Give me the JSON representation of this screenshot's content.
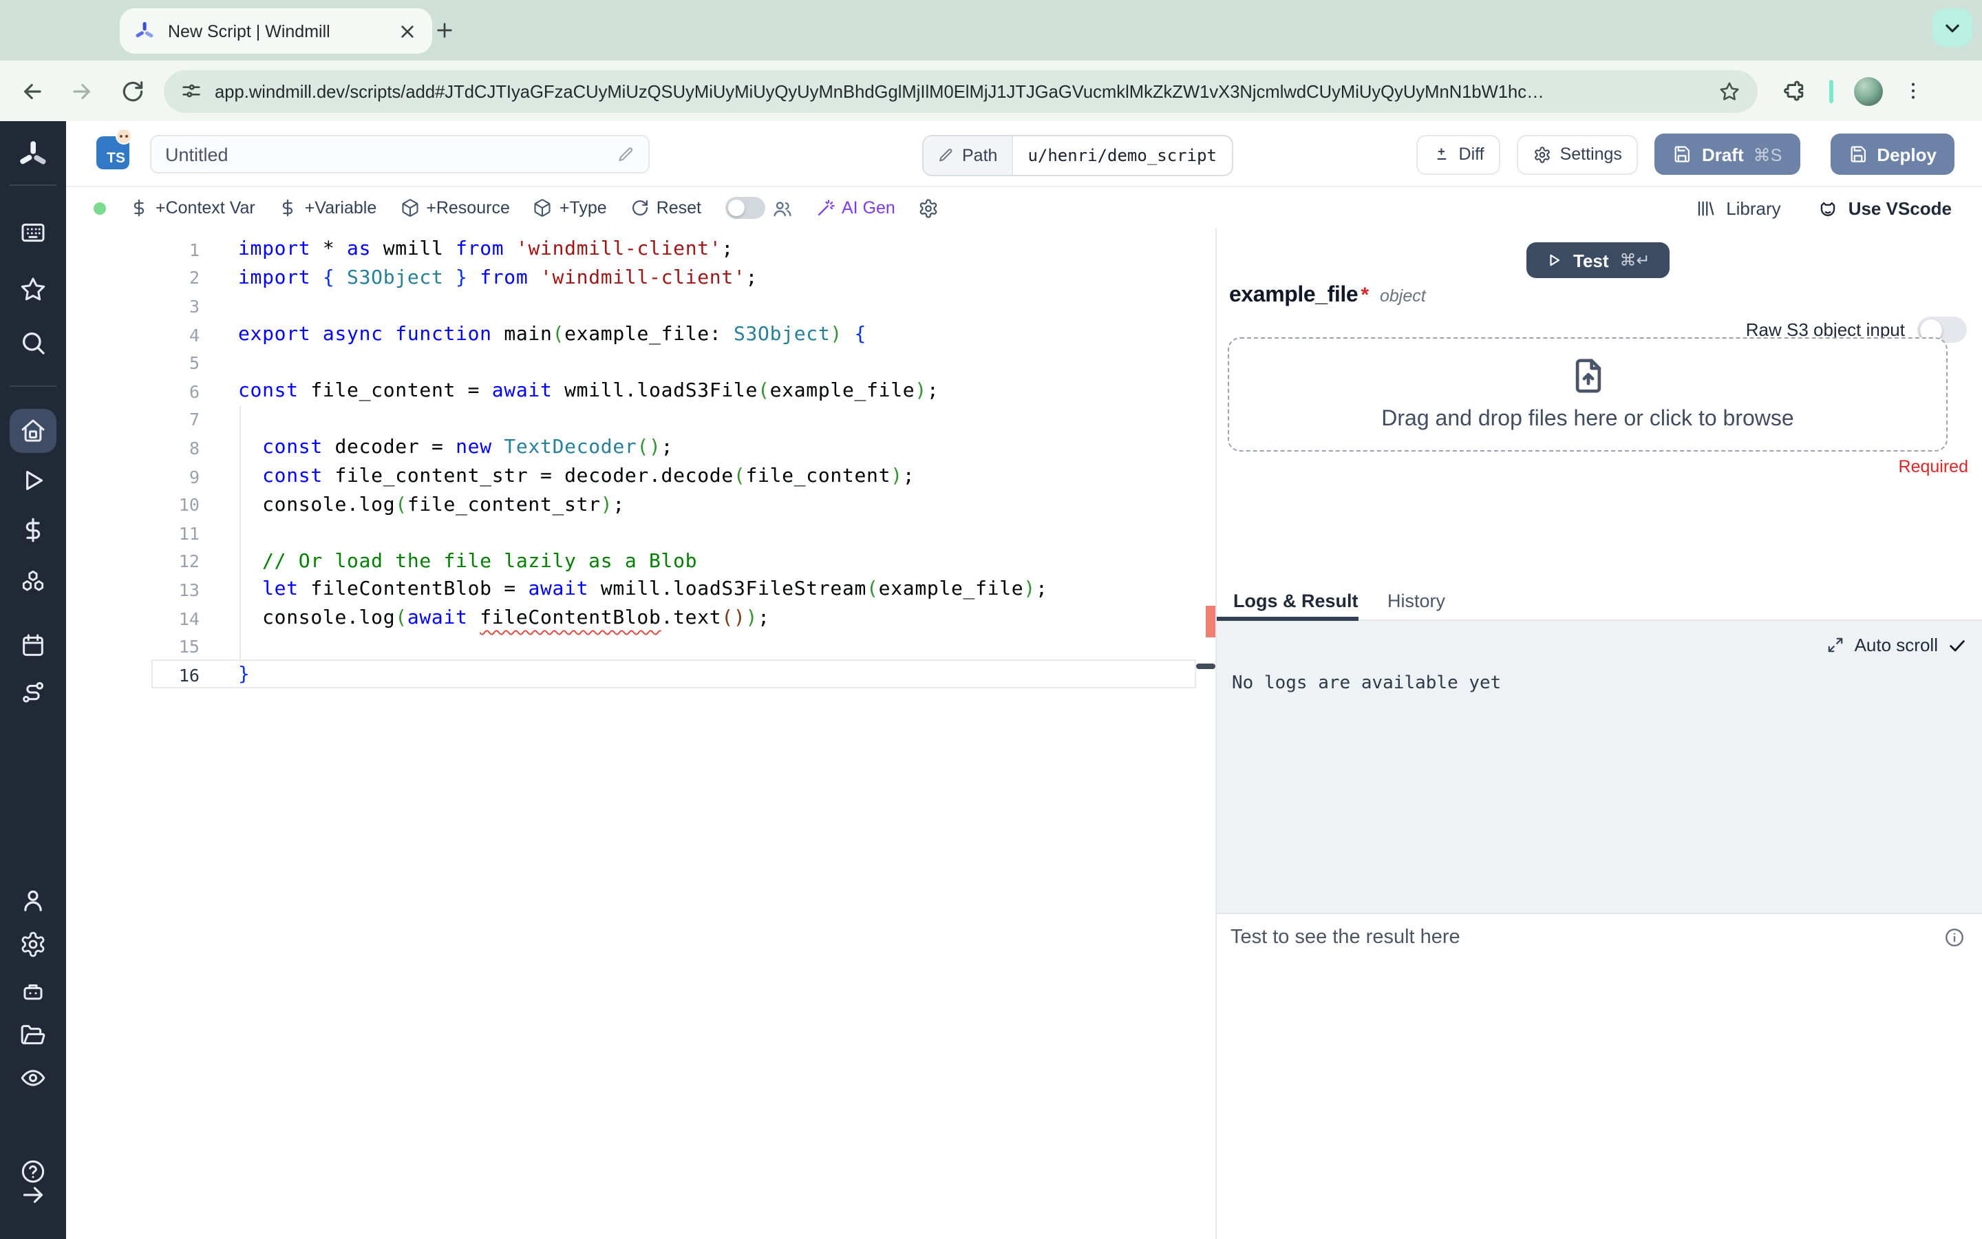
{
  "browser": {
    "tab_title": "New Script | Windmill",
    "url": "app.windmill.dev/scripts/add#JTdCJTIyaGFzaCUyMiUzQSUyMiUyMiUyQyUyMnBhdGglMjIlM0ElMjJ1JTJGaGVucmklMkZkZW1vX3NjcmlwdCUyMiUyQyUyMnN1bW1hc…"
  },
  "header": {
    "language_badge": "TS",
    "title": "Untitled",
    "path_label": "Path",
    "path_value": "u/henri/demo_script",
    "diff_label": "Diff",
    "settings_label": "Settings",
    "draft_label": "Draft",
    "draft_shortcut": "⌘S",
    "deploy_label": "Deploy"
  },
  "toolbar": {
    "context_var": "+Context Var",
    "variable": "+Variable",
    "resource": "+Resource",
    "type": "+Type",
    "reset": "Reset",
    "ai_gen": "AI Gen",
    "library": "Library",
    "use_vscode": "Use VScode"
  },
  "sidebar": {
    "items": [
      {
        "name": "windmill-logo",
        "icon": "windmill-logo"
      },
      {
        "name": "divider"
      },
      {
        "name": "sidebar-item-apps",
        "icon": "apps"
      },
      {
        "name": "sidebar-item-favorites",
        "icon": "favorites"
      },
      {
        "name": "sidebar-item-search",
        "icon": "search"
      },
      {
        "name": "divider"
      },
      {
        "name": "sidebar-item-home",
        "icon": "home",
        "active": true
      },
      {
        "name": "sidebar-item-runs",
        "icon": "runs"
      },
      {
        "name": "sidebar-item-variables",
        "icon": "variables"
      },
      {
        "name": "sidebar-item-resources",
        "icon": "resources"
      },
      {
        "name": "sidebar-item-schedules",
        "icon": "schedules"
      },
      {
        "name": "sidebar-item-flows",
        "icon": "flows"
      },
      {
        "name": "sidebar-item-user",
        "icon": "user"
      },
      {
        "name": "sidebar-item-settings",
        "icon": "settings"
      },
      {
        "name": "sidebar-item-workers",
        "icon": "workers"
      },
      {
        "name": "sidebar-item-folders",
        "icon": "folders"
      },
      {
        "name": "sidebar-item-audit-logs",
        "icon": "audit-logs"
      },
      {
        "name": "sidebar-item-help",
        "icon": "help"
      },
      {
        "name": "sidebar-item-expand",
        "icon": "collapse"
      }
    ]
  },
  "editor": {
    "lines": [
      {
        "n": 1,
        "tokens": [
          [
            "k",
            "import "
          ],
          [
            "d",
            "* "
          ],
          [
            "k",
            "as "
          ],
          [
            "d",
            "wmill "
          ],
          [
            "k",
            "from "
          ],
          [
            "s",
            "'windmill-client'"
          ],
          [
            "d",
            ";"
          ]
        ]
      },
      {
        "n": 2,
        "tokens": [
          [
            "k",
            "import "
          ],
          [
            "b",
            "{ "
          ],
          [
            "t",
            "S3Object"
          ],
          [
            "b",
            " }"
          ],
          [
            "d",
            " "
          ],
          [
            "k",
            "from "
          ],
          [
            "s",
            "'windmill-client'"
          ],
          [
            "d",
            ";"
          ]
        ]
      },
      {
        "n": 3,
        "tokens": []
      },
      {
        "n": 4,
        "tokens": [
          [
            "k",
            "export "
          ],
          [
            "k",
            "async "
          ],
          [
            "k",
            "function "
          ],
          [
            "d",
            "main"
          ],
          [
            "p",
            "("
          ],
          [
            "d",
            "example_file: "
          ],
          [
            "t",
            "S3Object"
          ],
          [
            "p",
            ")"
          ],
          [
            "d",
            " "
          ],
          [
            "b",
            "{"
          ]
        ]
      },
      {
        "n": 5,
        "tokens": []
      },
      {
        "n": 6,
        "tokens": [
          [
            "k",
            "const "
          ],
          [
            "d",
            "file_content = "
          ],
          [
            "k",
            "await "
          ],
          [
            "d",
            "wmill.loadS3File"
          ],
          [
            "p",
            "("
          ],
          [
            "d",
            "example_file"
          ],
          [
            "p",
            ")"
          ],
          [
            "d",
            ";"
          ]
        ]
      },
      {
        "n": 7,
        "tokens": []
      },
      {
        "n": 8,
        "tokens": [
          [
            "d",
            "  "
          ],
          [
            "k",
            "const "
          ],
          [
            "d",
            "decoder = "
          ],
          [
            "k",
            "new "
          ],
          [
            "t",
            "TextDecoder"
          ],
          [
            "p",
            "()"
          ],
          [
            "d",
            ";"
          ]
        ]
      },
      {
        "n": 9,
        "tokens": [
          [
            "d",
            "  "
          ],
          [
            "k",
            "const "
          ],
          [
            "d",
            "file_content_str = decoder.decode"
          ],
          [
            "p",
            "("
          ],
          [
            "d",
            "file_content"
          ],
          [
            "p",
            ")"
          ],
          [
            "d",
            ";"
          ]
        ]
      },
      {
        "n": 10,
        "tokens": [
          [
            "d",
            "  console.log"
          ],
          [
            "p",
            "("
          ],
          [
            "d",
            "file_content_str"
          ],
          [
            "p",
            ")"
          ],
          [
            "d",
            ";"
          ]
        ]
      },
      {
        "n": 11,
        "tokens": []
      },
      {
        "n": 12,
        "tokens": [
          [
            "d",
            "  "
          ],
          [
            "c",
            "// Or load the file lazily as a Blob"
          ]
        ]
      },
      {
        "n": 13,
        "tokens": [
          [
            "d",
            "  "
          ],
          [
            "k",
            "let "
          ],
          [
            "d",
            "fileContentBlob = "
          ],
          [
            "k",
            "await "
          ],
          [
            "d",
            "wmill.loadS3FileStream"
          ],
          [
            "p",
            "("
          ],
          [
            "d",
            "example_file"
          ],
          [
            "p",
            ")"
          ],
          [
            "d",
            ";"
          ]
        ]
      },
      {
        "n": 14,
        "tokens": [
          [
            "d",
            "  console.log"
          ],
          [
            "p",
            "("
          ],
          [
            "k",
            "await "
          ],
          [
            "w",
            "fileContentBlob"
          ],
          [
            "d",
            ".text"
          ],
          [
            "p2",
            "()"
          ],
          [
            "p",
            ")"
          ],
          [
            "d",
            ";"
          ]
        ]
      },
      {
        "n": 15,
        "tokens": []
      },
      {
        "n": 16,
        "tokens": [
          [
            "b",
            "}"
          ]
        ],
        "active": true
      }
    ]
  },
  "panel": {
    "test_label": "Test",
    "test_shortcut": "⌘↵",
    "arg_name": "example_file",
    "arg_required_mark": "*",
    "arg_type": "object",
    "raw_s3_label": "Raw S3 object input",
    "dropzone_text": "Drag and drop files here or click to browse",
    "required_label": "Required",
    "tab_logs": "Logs & Result",
    "tab_history": "History",
    "auto_scroll": "Auto scroll",
    "no_logs": "No logs are available yet",
    "result_placeholder": "Test to see the result here"
  },
  "colors": {
    "chrome_mint": "#cfe0d9",
    "chrome_toolbar": "#f2f7f4",
    "sidebar_bg": "#212937",
    "primary_button": "#6c82a6",
    "test_button": "#3a4b62",
    "ai_gen_accent": "#7c3aed",
    "status_dot": "#79db90",
    "required_red": "#dc2626",
    "active_tab_underline": "#334155",
    "ts_badge": "#3178c6"
  }
}
